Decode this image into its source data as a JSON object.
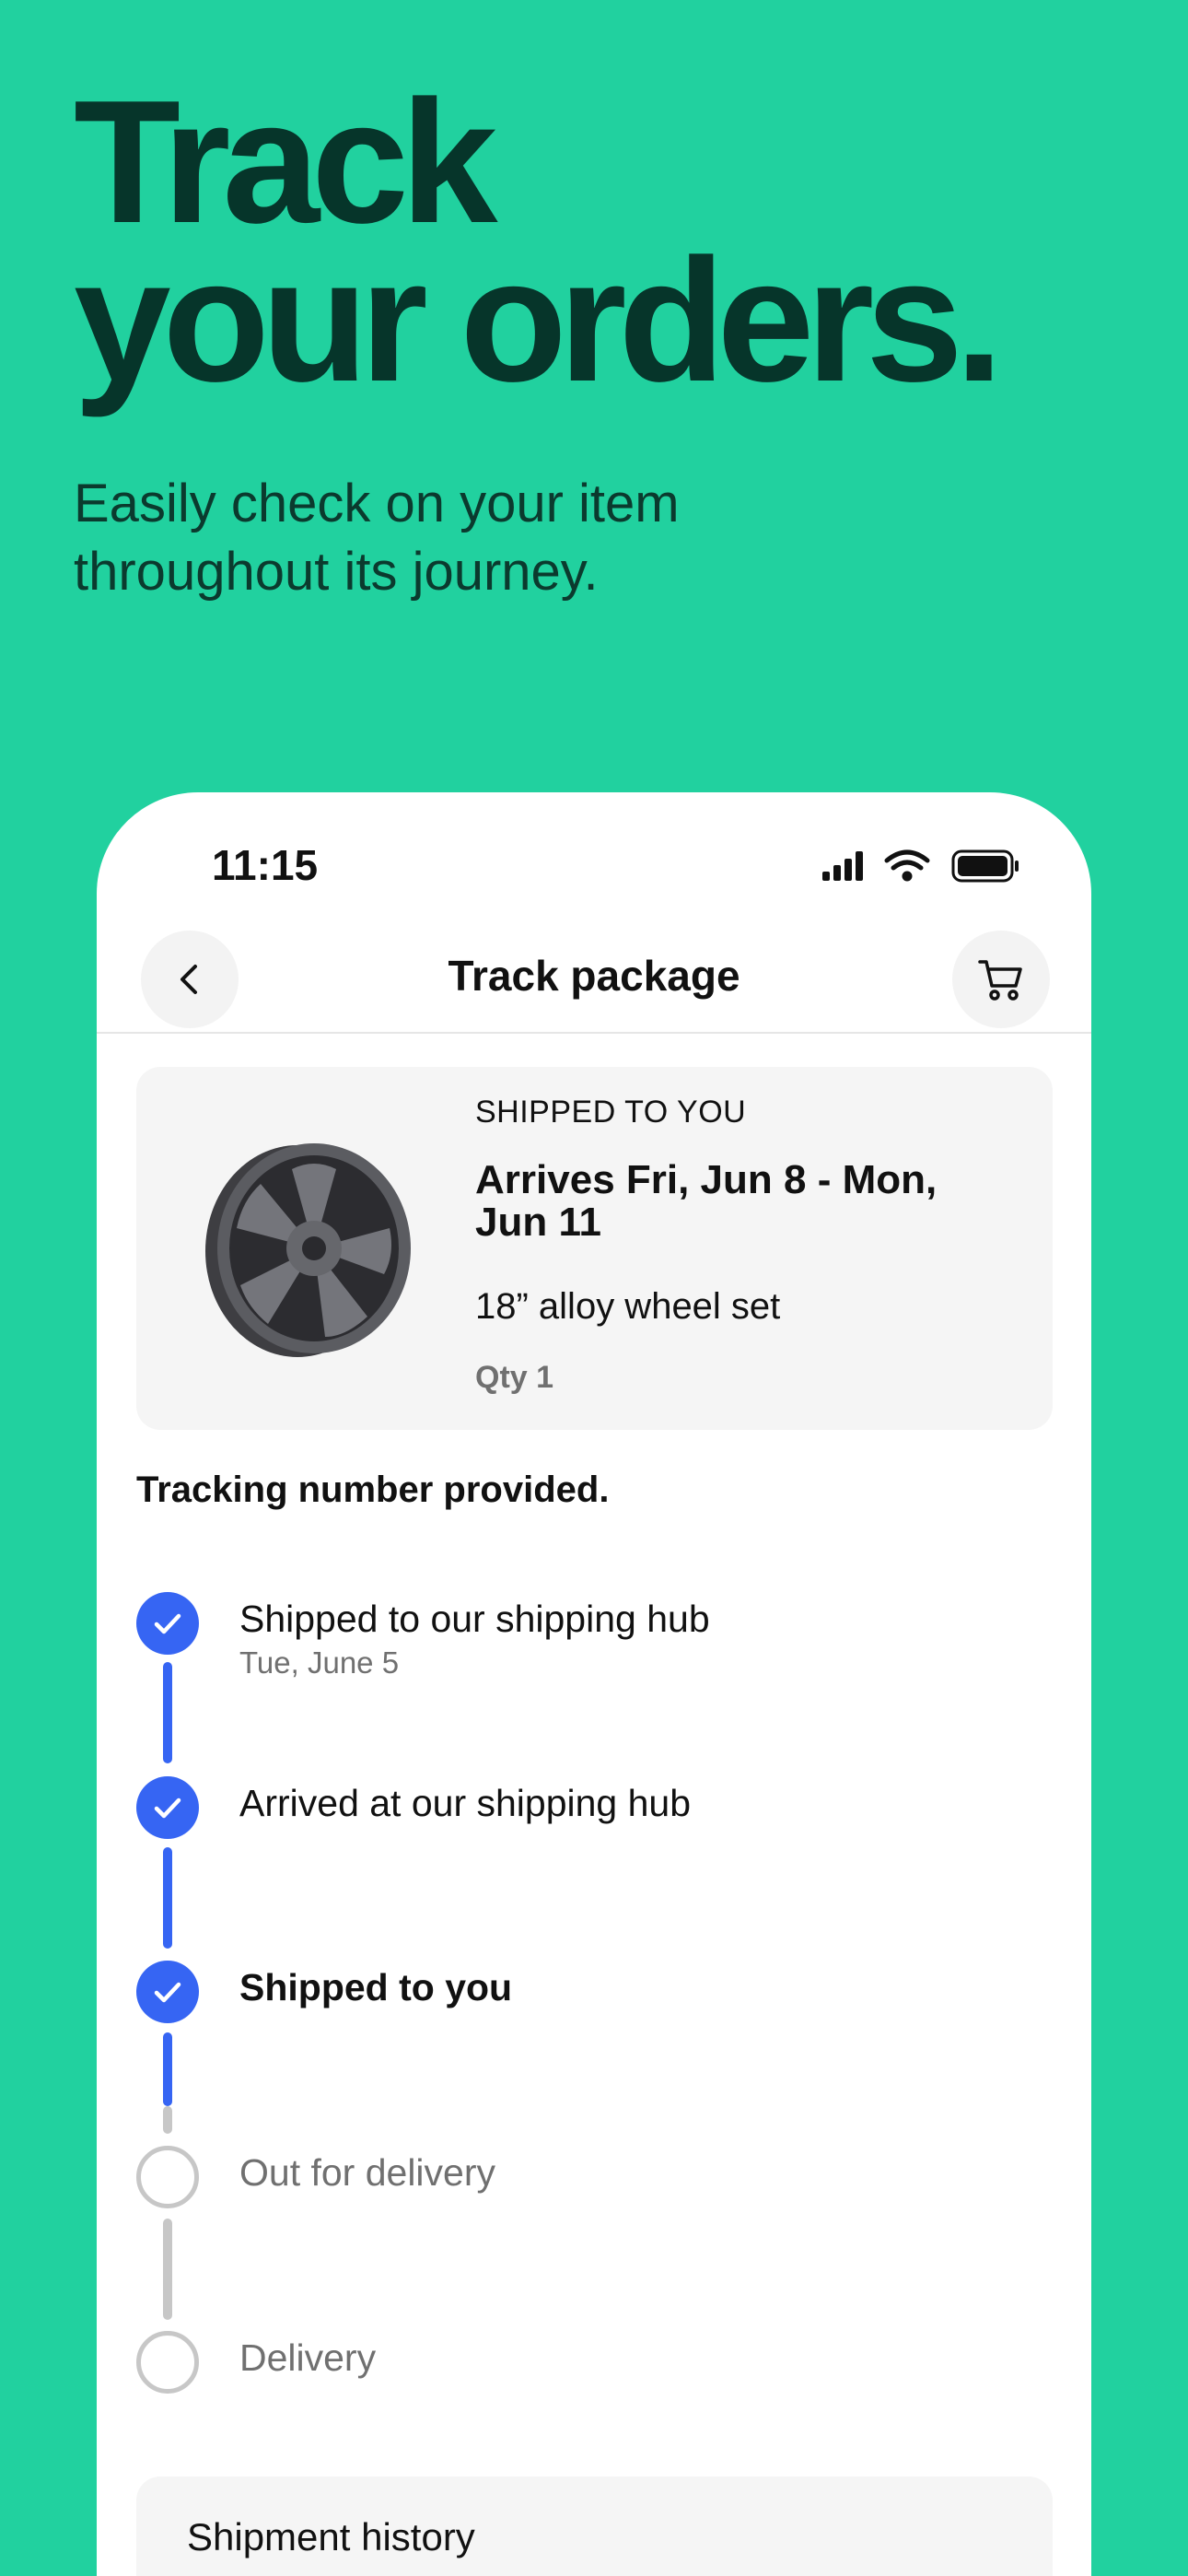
{
  "promo": {
    "headline_line1": "Track",
    "headline_line2": "your orders.",
    "subtitle": "Easily check on your item throughout its journey."
  },
  "status_bar": {
    "time": "11:15",
    "icons": [
      "cellular-signal-icon",
      "wifi-icon",
      "battery-icon"
    ]
  },
  "nav": {
    "back_icon": "chevron-left-icon",
    "title": "Track package",
    "cart_icon": "cart-icon"
  },
  "order": {
    "status_label": "SHIPPED TO YOU",
    "arrival": "Arrives Fri, Jun 8 - Mon, Jun 11",
    "item_name": "18” alloy wheel set",
    "qty": "Qty 1",
    "image": "alloy-wheel-image"
  },
  "tracking": {
    "note": "Tracking number provided.",
    "steps": [
      {
        "label": "Shipped to our shipping hub",
        "date": "Tue, June 5",
        "state": "done"
      },
      {
        "label": "Arrived at our shipping hub",
        "date": "",
        "state": "done"
      },
      {
        "label": "Shipped to you",
        "date": "",
        "state": "current"
      },
      {
        "label": "Out for delivery",
        "date": "",
        "state": "pending"
      },
      {
        "label": "Delivery",
        "date": "",
        "state": "pending"
      }
    ]
  },
  "history": {
    "title": "Shipment history"
  },
  "colors": {
    "background": "#21d19f",
    "headline": "#06352a",
    "accent": "#3665f3",
    "pending": "#c7c7c7"
  }
}
